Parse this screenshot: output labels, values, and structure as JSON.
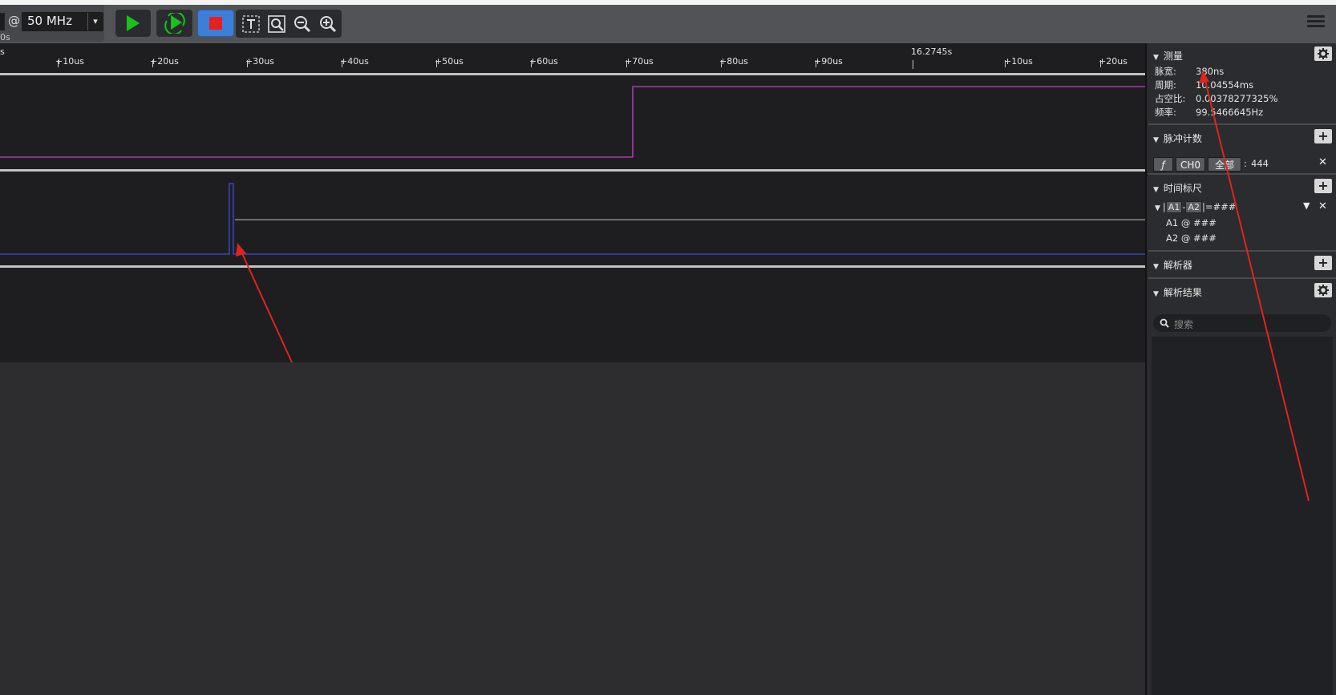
{
  "toolbar": {
    "at_symbol": "@",
    "sample_rate": "50 MHz",
    "dropdown_arrow": "▾",
    "sub_time": "0s",
    "icons": [
      "run-icon",
      "loop-run-icon",
      "stop-icon",
      "zoom-text-icon",
      "zoom-fit-icon",
      "zoom-out-icon",
      "zoom-in-icon",
      "menu-icon"
    ]
  },
  "ruler": {
    "ticks": [
      "s",
      "+10us",
      "+20us",
      "+30us",
      "+40us",
      "+50us",
      "+60us",
      "+70us",
      "+80us",
      "+90us",
      "16.2745s",
      "+10us",
      "+20us"
    ]
  },
  "panel": {
    "measure": {
      "title": "测量",
      "rows": [
        {
          "key": "脉宽:",
          "value": "380ns"
        },
        {
          "key": "周期:",
          "value": "10.04554ms"
        },
        {
          "key": "占空比:",
          "value": "0.00378277325%"
        },
        {
          "key": "频率:",
          "value": "99.5466645Hz"
        }
      ]
    },
    "pulse_count": {
      "title": "脉冲计数",
      "edge_symbol": "ƒ",
      "channel": "CH0",
      "scope": "全部",
      "colon": ":",
      "count": "444"
    },
    "time_ruler": {
      "title": "时间标尺",
      "formula_open": "|",
      "a1_tag": "A1",
      "minus": "-",
      "a2_tag": "A2",
      "formula_close": "|=###",
      "a1_row": "A1 @ ###",
      "a2_row": "A2 @ ###"
    },
    "decoder": {
      "title": "解析器"
    },
    "decode_result": {
      "title": "解析结果",
      "search_placeholder": "搜索"
    }
  },
  "colors": {
    "channel0": "#cc3fcf",
    "channel1": "#3b4fd8",
    "arrow": "#e0241c",
    "run_green": "#17c21a",
    "stop_red": "#e62020"
  }
}
